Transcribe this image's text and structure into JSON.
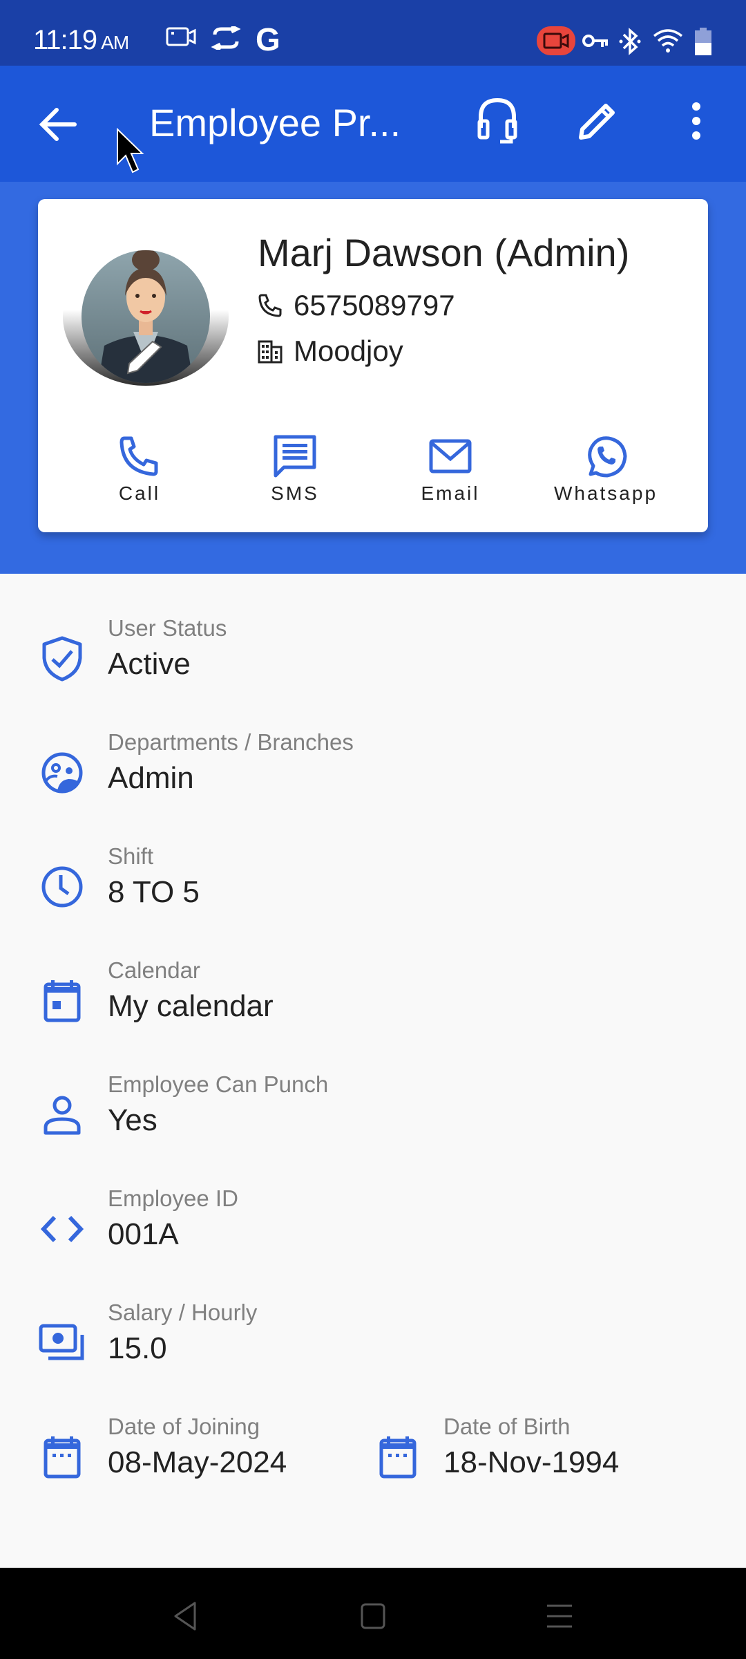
{
  "status_bar": {
    "time": "11:19",
    "ampm": "AM",
    "left_icons": [
      "screen-record-icon",
      "sync-icon",
      "google-icon"
    ],
    "right_icons": [
      "recording-active-icon",
      "vpn-key-icon",
      "bluetooth-icon",
      "wifi-icon",
      "battery-icon"
    ]
  },
  "app_bar": {
    "title": "Employee Pr...",
    "actions": [
      "headset-support-icon",
      "edit-pencil-icon",
      "more-vert-icon"
    ]
  },
  "profile": {
    "name": "Marj Dawson (Admin)",
    "phone": "6575089797",
    "company": "Moodjoy",
    "actions": [
      {
        "label": "Call",
        "icon": "phone-icon"
      },
      {
        "label": "SMS",
        "icon": "sms-icon"
      },
      {
        "label": "Email",
        "icon": "email-icon"
      },
      {
        "label": "Whatsapp",
        "icon": "whatsapp-icon"
      }
    ]
  },
  "details": [
    {
      "label": "User Status",
      "value": "Active",
      "icon": "verified-shield-icon"
    },
    {
      "label": "Departments / Branches",
      "value": "Admin",
      "icon": "groups-icon"
    },
    {
      "label": "Shift",
      "value": "8 TO 5",
      "icon": "clock-icon"
    },
    {
      "label": "Calendar",
      "value": "My calendar",
      "icon": "calendar-event-icon"
    },
    {
      "label": "Employee Can Punch",
      "value": "Yes",
      "icon": "person-icon"
    },
    {
      "label": "Employee ID",
      "value": "001A",
      "icon": "code-icon"
    },
    {
      "label": "Salary / Hourly",
      "value": "15.0",
      "icon": "payments-icon"
    }
  ],
  "dates": [
    {
      "label": "Date of Joining",
      "value": "08-May-2024",
      "icon": "calendar-icon"
    },
    {
      "label": "Date of Birth",
      "value": "18-Nov-1994",
      "icon": "calendar-icon"
    }
  ],
  "colors": {
    "status_bar": "#1a40a7",
    "app_bar": "#1d57d9",
    "header_band": "#336ae1",
    "accent_icon": "#3567dc",
    "background": "#f9f9f9",
    "recording_badge": "#e8453c"
  }
}
